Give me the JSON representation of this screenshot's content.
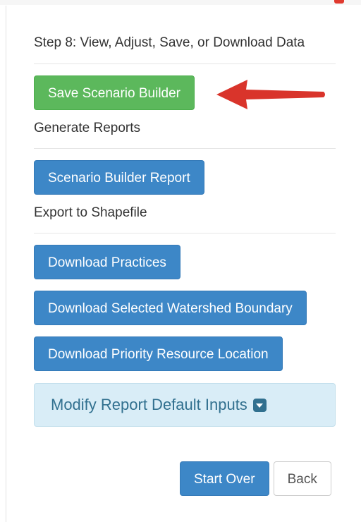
{
  "step": {
    "title": "Step 8: View, Adjust, Save, or Download Data"
  },
  "buttons": {
    "save_scenario": "Save Scenario Builder",
    "scenario_report": "Scenario Builder Report",
    "download_practices": "Download Practices",
    "download_watershed": "Download Selected Watershed Boundary",
    "download_priority": "Download Priority Resource Location"
  },
  "sections": {
    "generate_reports": "Generate Reports",
    "export_shapefile": "Export to Shapefile"
  },
  "collapse": {
    "label": "Modify Report Default Inputs",
    "icon": "caret-square-down-icon"
  },
  "footer": {
    "start_over": "Start Over",
    "back": "Back"
  },
  "colors": {
    "green_button": "#5cb85c",
    "blue_button": "#3d87c7",
    "info_panel": "#d9edf7",
    "annotation_arrow": "#d9342b"
  }
}
